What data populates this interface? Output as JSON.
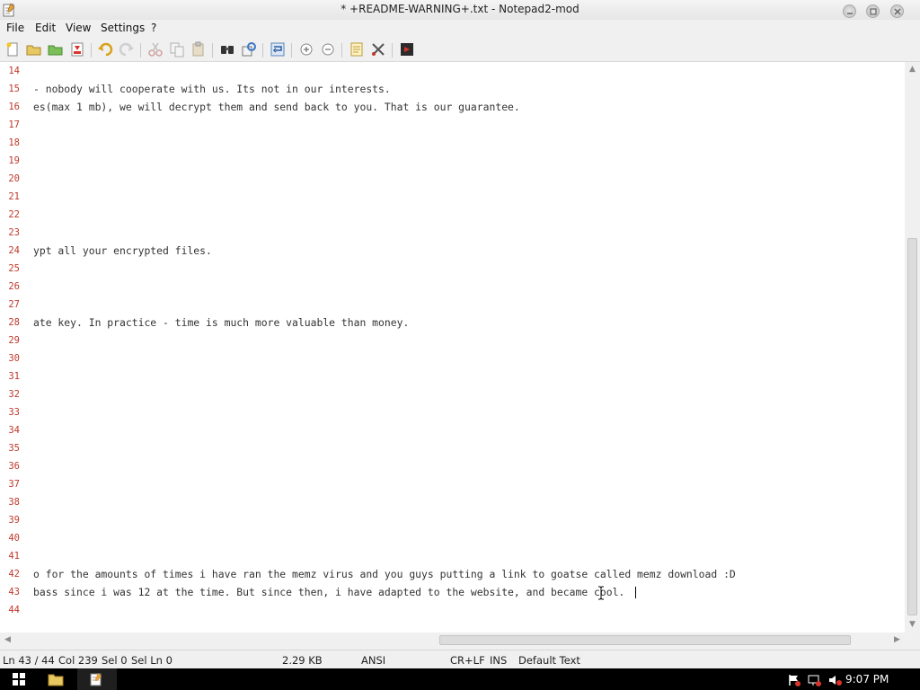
{
  "window": {
    "title": "* +README-WARNING+.txt - Notepad2-mod"
  },
  "menu": [
    "File",
    "Edit",
    "View",
    "Settings",
    "?"
  ],
  "toolbar": {
    "buttons": [
      "new-file",
      "open-file",
      "browse",
      "save",
      "undo",
      "redo",
      "cut",
      "copy",
      "paste",
      "find",
      "replace",
      "word-wrap",
      "zoom-in",
      "zoom-out",
      "scheme",
      "customize",
      "exit"
    ]
  },
  "editor": {
    "lines": [
      {
        "n": "14",
        "text": ""
      },
      {
        "n": "15",
        "text": "- nobody will cooperate with us. Its not in our interests."
      },
      {
        "n": "16",
        "text": "es(max 1 mb), we will decrypt them and send back to you. That is our guarantee."
      },
      {
        "n": "17",
        "text": ""
      },
      {
        "n": "18",
        "text": ""
      },
      {
        "n": "19",
        "text": ""
      },
      {
        "n": "20",
        "text": ""
      },
      {
        "n": "21",
        "text": ""
      },
      {
        "n": "22",
        "text": ""
      },
      {
        "n": "23",
        "text": ""
      },
      {
        "n": "24",
        "text": "ypt all your encrypted files."
      },
      {
        "n": "25",
        "text": ""
      },
      {
        "n": "26",
        "text": ""
      },
      {
        "n": "27",
        "text": ""
      },
      {
        "n": "28",
        "text": "ate key. In practice - time is much more valuable than money."
      },
      {
        "n": "29",
        "text": ""
      },
      {
        "n": "30",
        "text": ""
      },
      {
        "n": "31",
        "text": ""
      },
      {
        "n": "32",
        "text": ""
      },
      {
        "n": "33",
        "text": ""
      },
      {
        "n": "34",
        "text": ""
      },
      {
        "n": "35",
        "text": ""
      },
      {
        "n": "36",
        "text": ""
      },
      {
        "n": "37",
        "text": ""
      },
      {
        "n": "38",
        "text": ""
      },
      {
        "n": "39",
        "text": ""
      },
      {
        "n": "40",
        "text": ""
      },
      {
        "n": "41",
        "text": ""
      },
      {
        "n": "42",
        "text": "o for the amounts of times i have ran the memz virus and you guys putting a link to goatse called memz download :D"
      },
      {
        "n": "43",
        "text": "bass since i was 12 at the time. But since then, i have adapted to the website, and became cool."
      },
      {
        "n": "44",
        "text": ""
      }
    ]
  },
  "status": {
    "position": "Ln 43 / 44",
    "column": "Col 239",
    "selection": "Sel 0",
    "sel_lines": "Sel Ln 0",
    "size": "2.29 KB",
    "encoding": "ANSI",
    "line_ending": "CR+LF",
    "mode": "INS",
    "scheme": "Default Text"
  },
  "taskbar": {
    "clock": "9:07 PM"
  }
}
